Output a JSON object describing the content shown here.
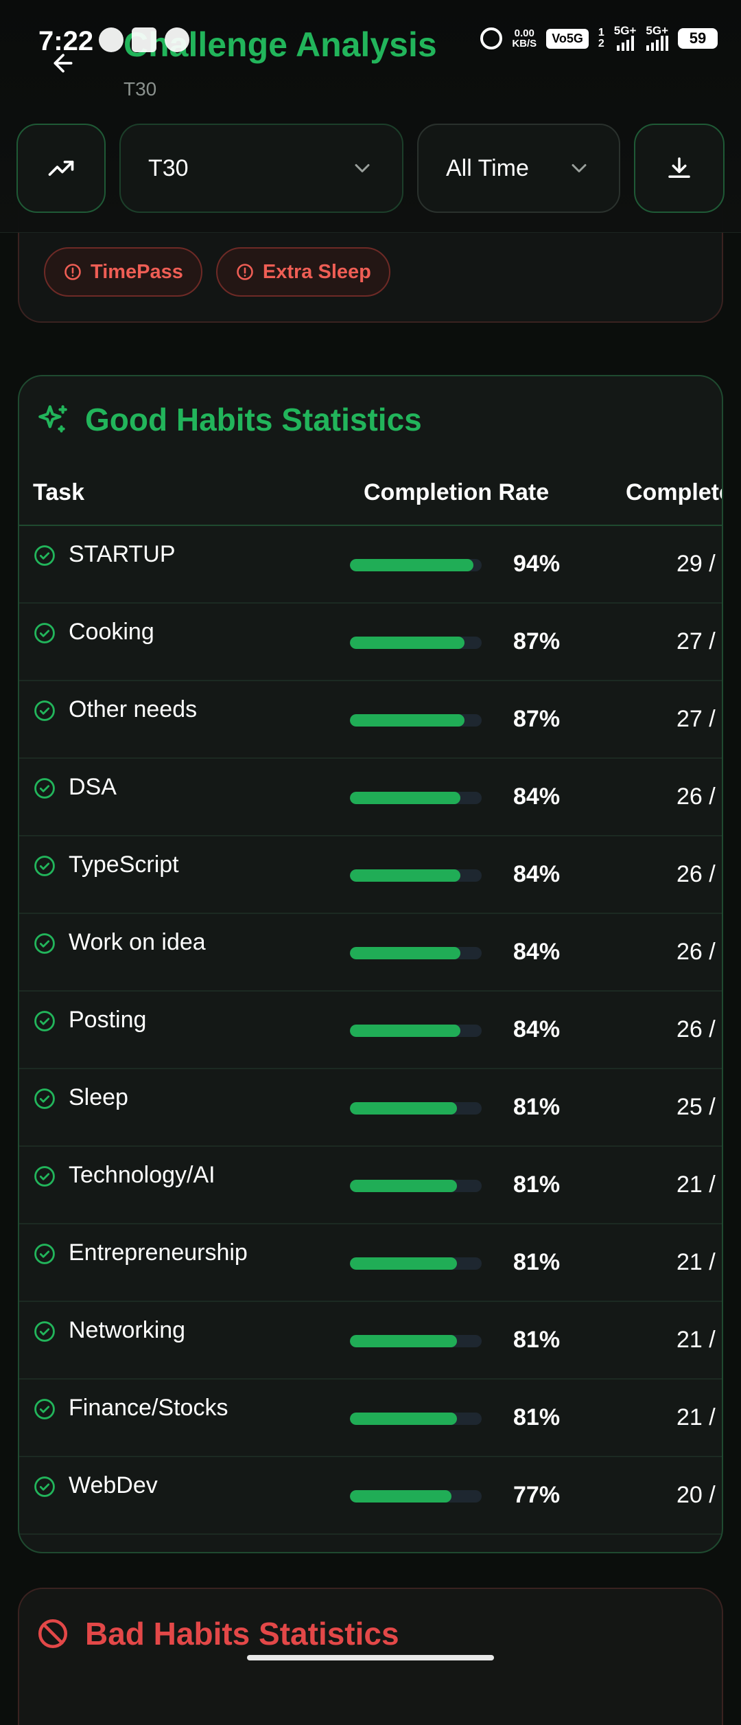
{
  "status_bar": {
    "time": "7:22",
    "net_speed_value": "0.00",
    "net_speed_unit": "KB/S",
    "volte": "Vo5G",
    "sim1": "1",
    "sim2": "2",
    "net1": "5G+",
    "net2": "5G+",
    "battery": "59"
  },
  "header": {
    "title": "Challenge Analysis",
    "subtitle": "T30",
    "challenge_select": {
      "value": "T30"
    },
    "range_select": {
      "value": "All Time"
    }
  },
  "prev_card": {
    "chips": [
      "TimePass",
      "Extra Sleep"
    ]
  },
  "good_habits": {
    "title": "Good Habits Statistics",
    "columns": {
      "task": "Task",
      "rate": "Completion Rate",
      "completed": "Complete"
    },
    "rows": [
      {
        "task": "STARTUP",
        "rate": 94,
        "rate_label": "94%",
        "completed": "29 /"
      },
      {
        "task": "Cooking",
        "rate": 87,
        "rate_label": "87%",
        "completed": "27 /"
      },
      {
        "task": "Other needs",
        "rate": 87,
        "rate_label": "87%",
        "completed": "27 /"
      },
      {
        "task": "DSA",
        "rate": 84,
        "rate_label": "84%",
        "completed": "26 /"
      },
      {
        "task": "TypeScript",
        "rate": 84,
        "rate_label": "84%",
        "completed": "26 /"
      },
      {
        "task": "Work on idea",
        "rate": 84,
        "rate_label": "84%",
        "completed": "26 /"
      },
      {
        "task": "Posting",
        "rate": 84,
        "rate_label": "84%",
        "completed": "26 /"
      },
      {
        "task": "Sleep",
        "rate": 81,
        "rate_label": "81%",
        "completed": "25 /"
      },
      {
        "task": "Technology/AI",
        "rate": 81,
        "rate_label": "81%",
        "completed": "21 /"
      },
      {
        "task": "Entrepreneurship",
        "rate": 81,
        "rate_label": "81%",
        "completed": "21 /"
      },
      {
        "task": "Networking",
        "rate": 81,
        "rate_label": "81%",
        "completed": "21 /"
      },
      {
        "task": "Finance/Stocks",
        "rate": 81,
        "rate_label": "81%",
        "completed": "21 /"
      },
      {
        "task": "WebDev",
        "rate": 77,
        "rate_label": "77%",
        "completed": "20 /"
      }
    ]
  },
  "bad_habits": {
    "title": "Bad Habits Statistics"
  },
  "colors": {
    "accent_green": "#22b55b",
    "bar_fill": "#20ad56",
    "bad_red": "#e34848",
    "chip_red": "#ef5e55",
    "background": "#0b0e0c"
  },
  "icons": {
    "back": "arrow-left-icon",
    "trend": "trending-up-icon",
    "chevron": "chevron-down-icon",
    "download": "download-icon",
    "chip": "alert-circle-icon",
    "sparkles": "sparkles-icon",
    "check": "check-circle-icon",
    "ban": "ban-icon"
  }
}
